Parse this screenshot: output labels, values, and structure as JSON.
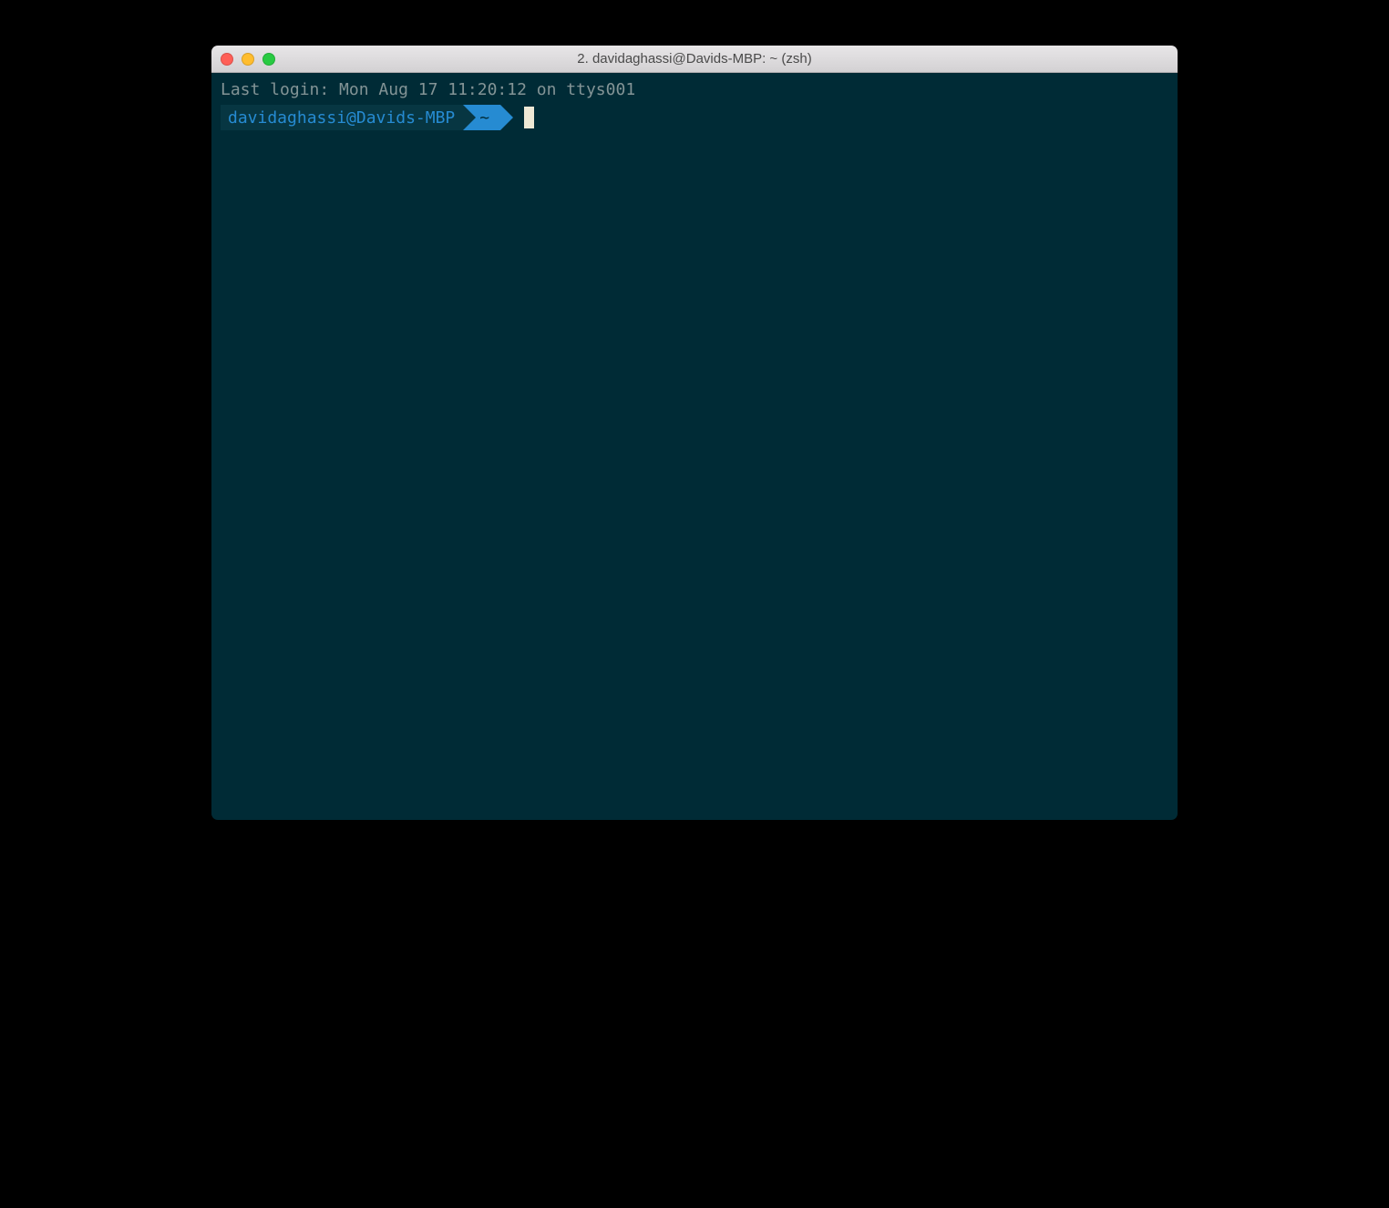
{
  "window": {
    "title": "2. davidaghassi@Davids-MBP: ~ (zsh)"
  },
  "terminal": {
    "last_login": "Last login: Mon Aug 17 11:20:12 on ttys001",
    "prompt": {
      "user_host": "davidaghassi@Davids-MBP",
      "path": "~"
    }
  },
  "colors": {
    "background": "#002b36",
    "foreground": "#839496",
    "prompt_blue": "#268bd2",
    "prompt_dark": "#073642",
    "cursor": "#eee8d5"
  }
}
